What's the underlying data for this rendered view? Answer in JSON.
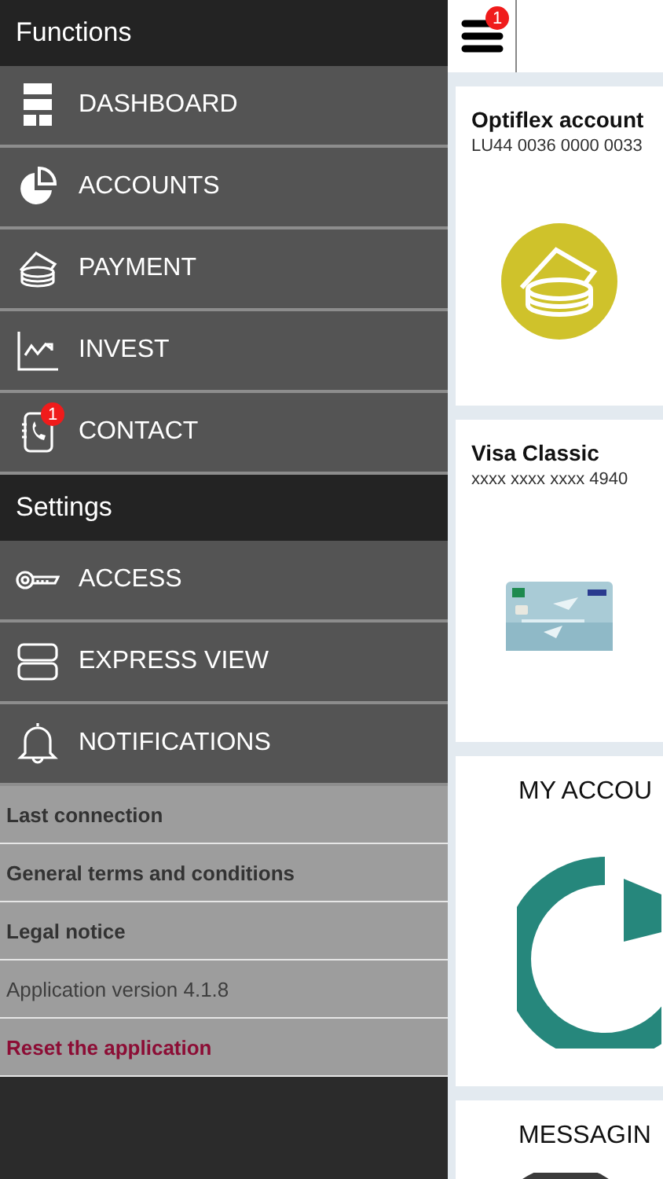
{
  "sidebar": {
    "sections": [
      {
        "title": "Functions",
        "items": [
          {
            "kind": "dashboard",
            "label": "DASHBOARD"
          },
          {
            "kind": "accounts",
            "label": "ACCOUNTS"
          },
          {
            "kind": "payment",
            "label": "PAYMENT"
          },
          {
            "kind": "invest",
            "label": "INVEST"
          },
          {
            "kind": "contact",
            "label": "CONTACT",
            "badge": "1"
          }
        ]
      },
      {
        "title": "Settings",
        "items": [
          {
            "kind": "access",
            "label": "ACCESS"
          },
          {
            "kind": "express",
            "label": "EXPRESS VIEW"
          },
          {
            "kind": "bell",
            "label": "NOTIFICATIONS"
          }
        ]
      }
    ],
    "links": [
      {
        "kind": "link",
        "label": "Last connection"
      },
      {
        "kind": "link",
        "label": "General terms and conditions"
      },
      {
        "kind": "link",
        "label": "Legal notice"
      },
      {
        "kind": "info",
        "label": "Application version 4.1.8"
      },
      {
        "kind": "danger",
        "label": "Reset the application"
      }
    ]
  },
  "header": {
    "menu_badge": "1"
  },
  "cards": [
    {
      "kind": "account",
      "title": "Optiflex account",
      "subtitle": "LU44 0036 0000 0033"
    },
    {
      "kind": "card",
      "title": "Visa Classic",
      "subtitle": "xxxx xxxx xxxx 4940"
    },
    {
      "kind": "pie-tile",
      "title": "MY ACCOU"
    },
    {
      "kind": "message-tile",
      "title": "MESSAGIN"
    }
  ]
}
